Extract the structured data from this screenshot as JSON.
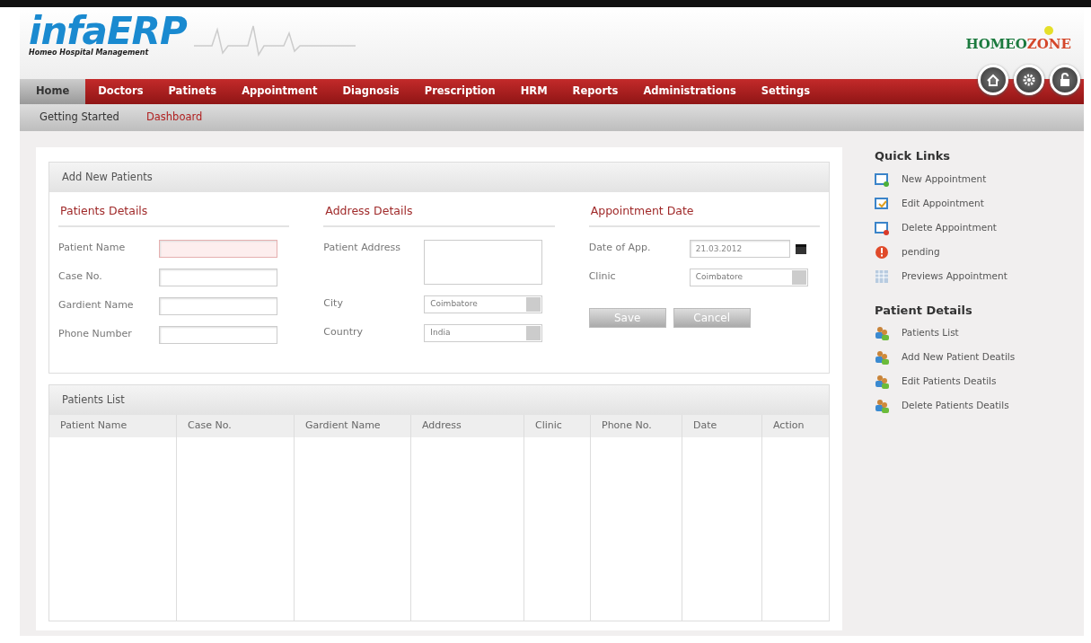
{
  "logo": {
    "name": "infaERP",
    "tagline": "Homeo Hospital Management"
  },
  "brand": {
    "left": "HOMEO",
    "right": "ZONE"
  },
  "nav": [
    {
      "label": "Home",
      "selected": true
    },
    {
      "label": "Doctors",
      "selected": false
    },
    {
      "label": "Patinets",
      "selected": false
    },
    {
      "label": "Appointment",
      "selected": false
    },
    {
      "label": "Diagnosis",
      "selected": false
    },
    {
      "label": "Prescription",
      "selected": false
    },
    {
      "label": "HRM",
      "selected": false
    },
    {
      "label": "Reports",
      "selected": false
    },
    {
      "label": "Administrations",
      "selected": false
    },
    {
      "label": "Settings",
      "selected": false
    }
  ],
  "subnav": [
    {
      "label": "Getting Started",
      "selected": false
    },
    {
      "label": "Dashboard",
      "selected": true
    }
  ],
  "form": {
    "title": "Add New Patients",
    "sections": [
      {
        "title": "Patients Details",
        "fields": [
          {
            "kind": "text",
            "label": "Patient Name",
            "invalid": true
          },
          {
            "kind": "text",
            "label": "Case No.",
            "invalid": false
          },
          {
            "kind": "text",
            "label": "Gardient Name",
            "invalid": false
          },
          {
            "kind": "text",
            "label": "Phone Number",
            "invalid": false
          }
        ]
      },
      {
        "title": "Address Details",
        "fields": [
          {
            "kind": "textarea",
            "label": "Patient Address",
            "invalid": false
          },
          {
            "kind": "select",
            "label": "City",
            "value": "Coimbatore",
            "invalid": false
          },
          {
            "kind": "select",
            "label": "Country",
            "value": "India",
            "invalid": false
          }
        ]
      },
      {
        "title": "Appointment Date",
        "fields": [
          {
            "kind": "date",
            "label": "Date of App.",
            "value": "21.03.2012",
            "invalid": false
          },
          {
            "kind": "select",
            "label": "Clinic",
            "value": "Coimbatore",
            "invalid": false
          }
        ],
        "buttons": [
          "Save",
          "Cancel"
        ]
      }
    ]
  },
  "table": {
    "title": "Patients List",
    "columns": [
      "Patient Name",
      "Case No.",
      "Gardient Name",
      "Address",
      "Clinic",
      "Phone No.",
      "Date",
      "Action"
    ]
  },
  "sidebar": [
    {
      "title": "Quick Links",
      "items": [
        {
          "kind": "add",
          "label": "New Appointment"
        },
        {
          "kind": "edit",
          "label": "Edit Appointment"
        },
        {
          "kind": "remove",
          "label": "Delete Appointment"
        },
        {
          "kind": "alert",
          "label": "pending"
        },
        {
          "kind": "calendar",
          "label": "Previews Appointment"
        }
      ]
    },
    {
      "title": "Patient Details",
      "items": [
        {
          "kind": "people",
          "label": "Patients List"
        },
        {
          "kind": "people",
          "label": "Add New Patient Deatils"
        },
        {
          "kind": "people",
          "label": "Edit Patients Deatils"
        },
        {
          "kind": "people",
          "label": "Delete Patients Deatils"
        }
      ]
    }
  ]
}
